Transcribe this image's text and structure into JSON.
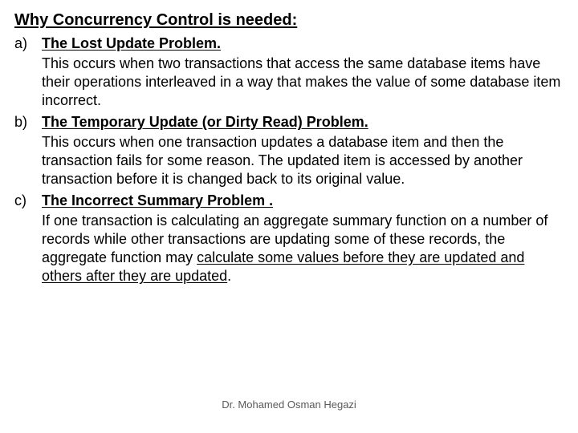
{
  "title": "Why Concurrency Control is needed:",
  "items": {
    "a": {
      "marker": "a)",
      "title": "The Lost Update Problem.",
      "desc": "This occurs when two transactions that access the same database items have their operations interleaved in a way that makes the value of some database item incorrect."
    },
    "b": {
      "marker": "b)",
      "title": "The Temporary Update (or Dirty Read) Problem.",
      "desc": "This occurs when one transaction updates a database item and then the transaction fails for some reason. The updated item is accessed by another transaction before it is changed back to its original value."
    },
    "c": {
      "marker": "c)",
      "title": "The Incorrect Summary Problem .",
      "desc_pre": "If one transaction is calculating an aggregate summary function on a number of records while other transactions are updating some of these records, the aggregate function may ",
      "desc_u": "calculate some values before they are updated and others after they are updated",
      "desc_post": "."
    }
  },
  "footer": "Dr. Mohamed Osman Hegazi"
}
